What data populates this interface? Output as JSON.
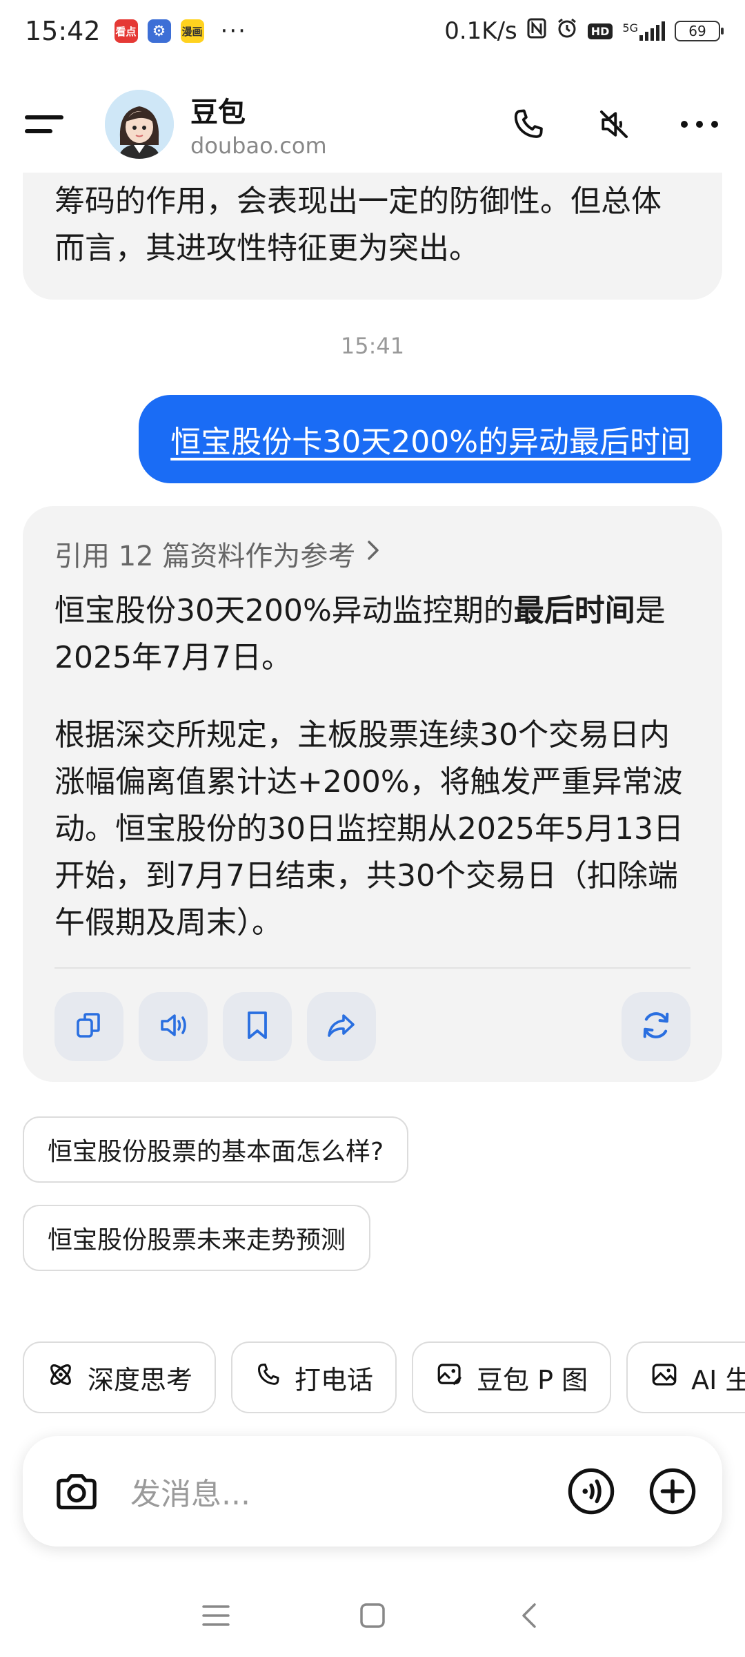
{
  "status_bar": {
    "time": "15:42",
    "app_icons": [
      "看点",
      "⚙",
      "漫画"
    ],
    "more": "···",
    "net_speed": "0.1K/s",
    "network": "5G",
    "battery": "69"
  },
  "header": {
    "name": "豆包",
    "subtitle": "doubao.com",
    "avatar_icon": "avatar-girl",
    "icons": [
      "menu-icon",
      "phone-icon",
      "speaker-mute-icon",
      "more-icon"
    ]
  },
  "chat": {
    "previous_message": "筹码的作用，会表现出一定的防御性。但总体而言，其进攻性特征更为突出。",
    "timestamp": "15:41",
    "user_message": "恒宝股份卡30天200%的异动最后时间",
    "reference_note": "引用 12 篇资料作为参考",
    "answer_p1_pre": "恒宝股份30天200%异动监控期的",
    "answer_p1_bold": "最后时间",
    "answer_p1_post": "是2025年7月7日。",
    "answer_p2": "根据深交所规定，主板股票连续30个交易日内涨幅偏离值累计达+200%，将触发严重异常波动。恒宝股份的30日监控期从2025年5月13日开始，到7月7日结束，共30个交易日（扣除端午假期及周末）。",
    "action_icons": [
      "copy-icon",
      "speaker-icon",
      "bookmark-icon",
      "share-icon",
      "regenerate-icon"
    ]
  },
  "suggestions": [
    "恒宝股份股票的基本面怎么样?",
    "恒宝股份股票未来走势预测"
  ],
  "tools": [
    {
      "label": "深度思考",
      "icon": "atom-icon"
    },
    {
      "label": "打电话",
      "icon": "phone-icon"
    },
    {
      "label": "豆包 P 图",
      "icon": "image-edit-icon"
    },
    {
      "label": "AI 生",
      "icon": "image-icon"
    }
  ],
  "input": {
    "placeholder": "发消息...",
    "icons": [
      "camera-icon",
      "voice-icon",
      "plus-icon"
    ]
  },
  "colors": {
    "accent": "#1a6cf5",
    "bubble_bg": "#f3f3f3",
    "action_icon": "#2a6fe0"
  }
}
